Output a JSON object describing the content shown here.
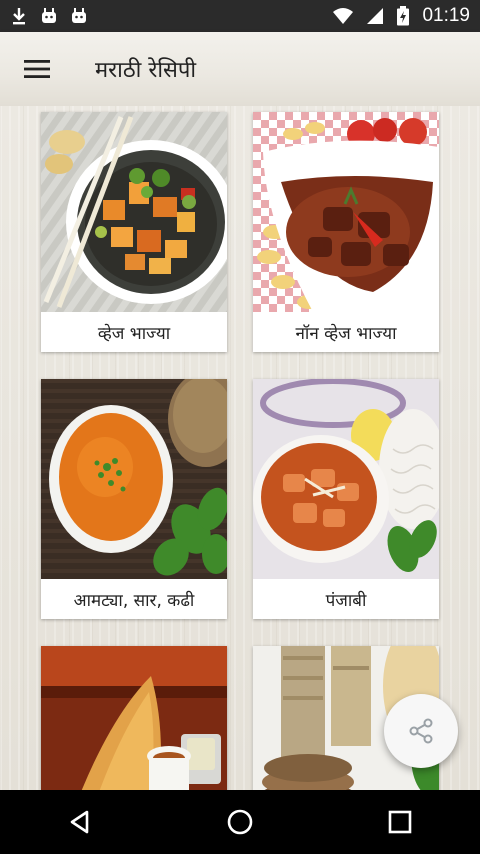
{
  "status_bar": {
    "time": "01:19",
    "left_icons": [
      "download-icon",
      "android-icon",
      "android-icon"
    ],
    "right_icons": [
      "wifi-icon",
      "signal-icon",
      "battery-icon"
    ]
  },
  "app_bar": {
    "title": "मराठी रेसिपी",
    "menu_icon": "hamburger-menu-icon"
  },
  "categories": [
    {
      "label": "व्हेज भाज्या",
      "image": "veg-curry-bowl"
    },
    {
      "label": "नॉन व्हेज भाज्या",
      "image": "meat-curry-bowl"
    },
    {
      "label": "आमट्या, सार, कढी",
      "image": "soup-bowl"
    },
    {
      "label": "पंजाबी",
      "image": "paneer-curry-bowl"
    },
    {
      "label": "",
      "image": "dosa-plate"
    },
    {
      "label": "",
      "image": "pancake-stack"
    }
  ],
  "fab": {
    "icon": "share-icon"
  },
  "nav_bar": {
    "icons": [
      "back-icon",
      "home-icon",
      "recents-icon"
    ]
  },
  "colors": {
    "status_bar": "#2b2b2b",
    "app_bar": "#efece6",
    "nav_bar": "#000000",
    "card_label_bg": "#ffffff"
  }
}
